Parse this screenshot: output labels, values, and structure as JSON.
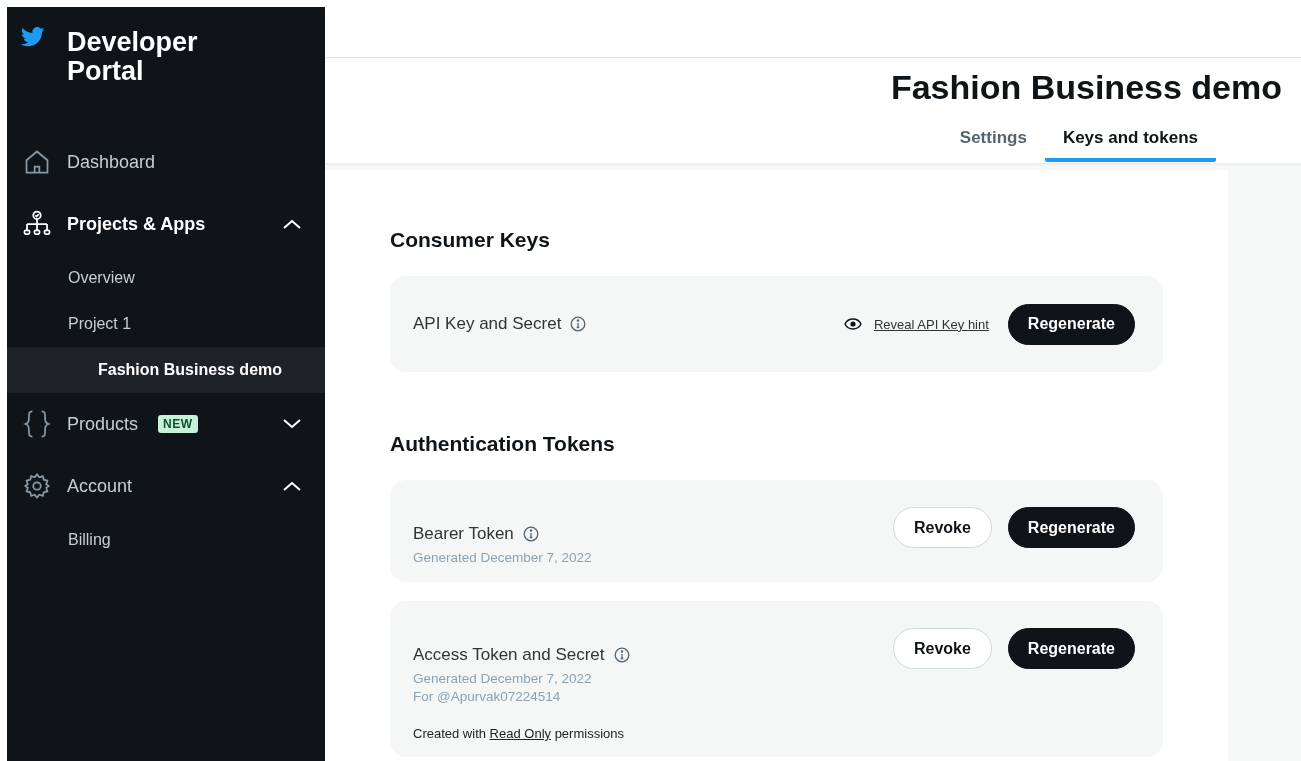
{
  "sidebar": {
    "title": "Developer Portal",
    "nav": [
      {
        "label": "Dashboard",
        "selected": false
      },
      {
        "label": "Projects & Apps",
        "selected": true,
        "expanded": true,
        "children": [
          {
            "label": "Overview",
            "selected": false
          },
          {
            "label": "Project 1",
            "selected": false,
            "children": [
              {
                "label": "Fashion Business demo",
                "selected": true
              }
            ]
          }
        ]
      },
      {
        "label": "Products",
        "badge": "NEW",
        "selected": false,
        "expanded": false
      },
      {
        "label": "Account",
        "selected": false,
        "expanded": true,
        "children": [
          {
            "label": "Billing",
            "selected": false
          }
        ]
      }
    ]
  },
  "header": {
    "title": "Fashion Business demo",
    "tabs": [
      {
        "label": "Settings",
        "selected": false
      },
      {
        "label": "Keys and tokens",
        "selected": true
      }
    ]
  },
  "sections": [
    {
      "heading": "Consumer Keys",
      "cards": [
        {
          "title": "API Key and Secret",
          "reveal_link": "Reveal API Key hint",
          "buttons": [
            {
              "label": "Regenerate",
              "kind": "primary"
            }
          ]
        }
      ]
    },
    {
      "heading": "Authentication Tokens",
      "cards": [
        {
          "title": "Bearer Token",
          "details": [
            "Generated December 7, 2022"
          ],
          "buttons": [
            {
              "label": "Revoke",
              "kind": "secondary"
            },
            {
              "label": "Regenerate",
              "kind": "primary"
            }
          ]
        },
        {
          "title": "Access Token and Secret",
          "details": [
            "Generated December 7, 2022",
            "For @Apurvak07224514"
          ],
          "note": {
            "before": "Created with ",
            "link": "Read Only",
            "after": " permissions"
          },
          "buttons": [
            {
              "label": "Revoke",
              "kind": "secondary"
            },
            {
              "label": "Regenerate",
              "kind": "primary"
            }
          ]
        }
      ]
    }
  ]
}
